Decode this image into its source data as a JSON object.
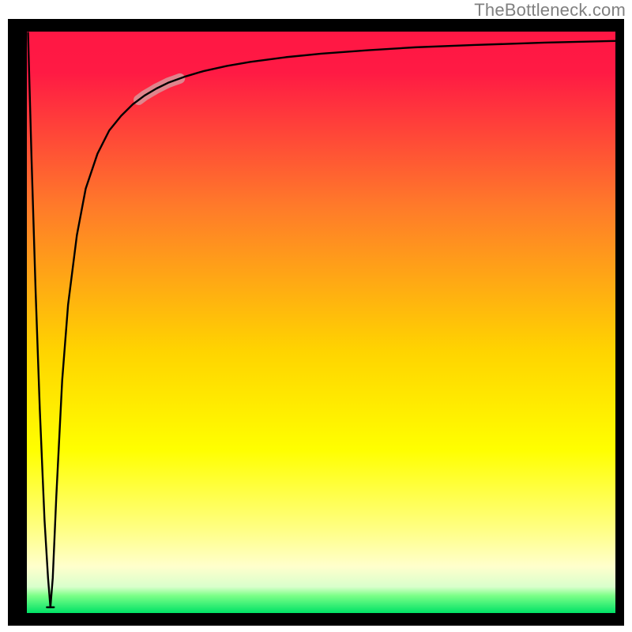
{
  "watermark": "TheBottleneck.com",
  "chart_data": {
    "type": "line",
    "title": "",
    "xlabel": "",
    "ylabel": "",
    "xlim": [
      0,
      100
    ],
    "ylim": [
      0,
      100
    ],
    "grid": false,
    "legend": false,
    "axes_visible": false,
    "description": "Gradient background from red (top) through orange, yellow, pale-yellow to thin green band at bottom. A single black curve: starts near top-left, plunges sharply to a narrow V-shaped minimum near x≈4 at the very bottom, then rises steeply and asymptotically flattens toward the top-right. A short thick semi-transparent pink overlay highlights a segment of the rising curve around x≈22.",
    "gradient_stops": [
      {
        "offset": 0.0,
        "color": "#ff1744"
      },
      {
        "offset": 0.07,
        "color": "#ff1a44"
      },
      {
        "offset": 0.3,
        "color": "#ff7a2a"
      },
      {
        "offset": 0.55,
        "color": "#ffd400"
      },
      {
        "offset": 0.72,
        "color": "#ffff00"
      },
      {
        "offset": 0.86,
        "color": "#ffff88"
      },
      {
        "offset": 0.92,
        "color": "#ffffcc"
      },
      {
        "offset": 0.955,
        "color": "#d9ffcc"
      },
      {
        "offset": 0.97,
        "color": "#7cff88"
      },
      {
        "offset": 1.0,
        "color": "#00e266"
      }
    ],
    "series": [
      {
        "name": "bottleneck-curve",
        "x": [
          0.2,
          0.8,
          1.5,
          2.2,
          3.0,
          3.6,
          4.0,
          4.4,
          5.0,
          6.0,
          7.0,
          8.5,
          10.0,
          12.0,
          14.0,
          16.0,
          18.0,
          20.0,
          22.0,
          24.0,
          27.0,
          30.0,
          34.0,
          38.0,
          44.0,
          50.0,
          58.0,
          66.0,
          76.0,
          88.0,
          100.0
        ],
        "y": [
          99.8,
          78.0,
          55.0,
          35.0,
          16.0,
          6.0,
          1.0,
          6.0,
          20.0,
          40.0,
          53.0,
          65.0,
          73.0,
          79.0,
          83.0,
          85.5,
          87.5,
          89.0,
          90.2,
          91.2,
          92.3,
          93.2,
          94.1,
          94.8,
          95.6,
          96.2,
          96.8,
          97.3,
          97.7,
          98.1,
          98.4
        ]
      }
    ],
    "highlight_segment": {
      "x_start": 19.0,
      "x_end": 26.0,
      "color": "#d89a9e",
      "opacity": 0.82,
      "width": 13
    },
    "minimum_plateau": {
      "x_start": 3.4,
      "x_end": 4.6,
      "y": 1.0
    }
  }
}
